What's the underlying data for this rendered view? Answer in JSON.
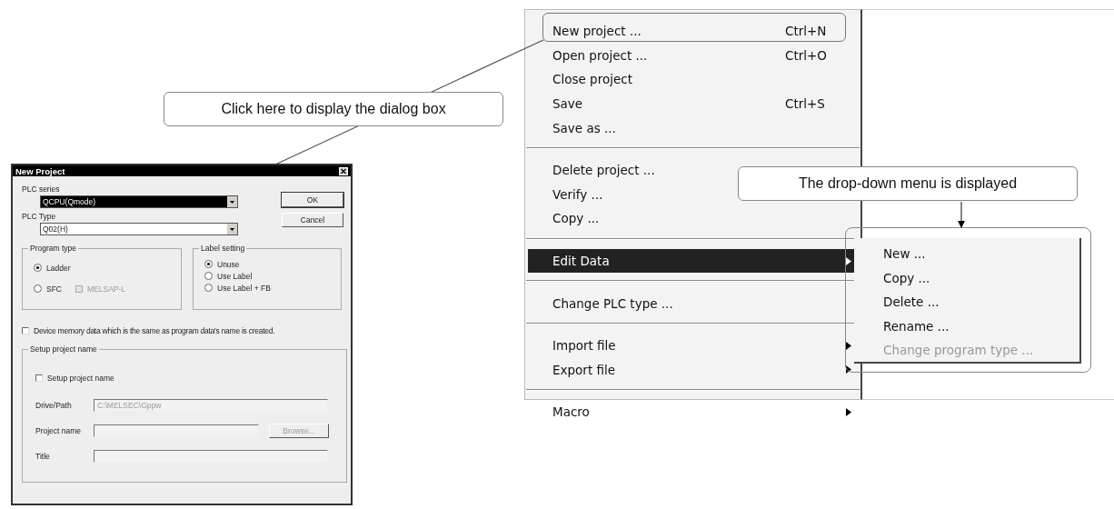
{
  "annotations": [
    {
      "text": "Click here to display the dialog box"
    },
    {
      "text": "The drop-down menu is displayed"
    }
  ],
  "dialog": {
    "title": "New Project",
    "plc_series": {
      "label": "PLC series",
      "value": "QCPU(Qmode)",
      "selected": true
    },
    "plc_type": {
      "label": "PLC Type",
      "value": "Q02(H)",
      "selected": false
    },
    "buttons": [
      {
        "label": "OK",
        "default": true
      },
      {
        "label": "Cancel",
        "default": false
      }
    ],
    "program_type": {
      "label": "Program type",
      "options": [
        {
          "kind": "radio",
          "label": "Ladder",
          "selected": true,
          "disabled": false
        },
        {
          "kind": "radio",
          "label": "SFC",
          "selected": false,
          "disabled": false
        },
        {
          "kind": "checkbox",
          "label": "MELSAP-L",
          "checked": false,
          "disabled": true
        }
      ]
    },
    "label_setting": {
      "label": "Label setting",
      "options": [
        {
          "kind": "radio",
          "label": "Unuse",
          "selected": true
        },
        {
          "kind": "radio",
          "label": "Use Label",
          "selected": false
        },
        {
          "kind": "radio",
          "label": "Use Label + FB",
          "selected": false
        }
      ]
    },
    "device_memory": {
      "label": "Device memory data which is the same as program data's name is created.",
      "checked": false
    },
    "setup": {
      "label": "Setup project name",
      "checkbox": {
        "label": "Setup project name",
        "checked": false
      },
      "fields": [
        {
          "label": "Drive/Path",
          "value": "C:\\MELSEC\\Gppw"
        },
        {
          "label": "Project name",
          "button": "Browse..."
        },
        {
          "label": "Title"
        }
      ]
    }
  },
  "menu": {
    "groups": [
      [
        {
          "label": "New project ...",
          "shortcut": "Ctrl+N",
          "selected": false,
          "submenu": false
        },
        {
          "label": "Open project ...",
          "shortcut": "Ctrl+O",
          "selected": false,
          "submenu": false
        },
        {
          "label": "Close project",
          "selected": false,
          "submenu": false
        },
        {
          "label": "Save",
          "shortcut": "Ctrl+S",
          "selected": false,
          "submenu": false
        },
        {
          "label": "Save as ...",
          "selected": false,
          "submenu": false
        }
      ],
      [
        {
          "label": "Delete project ...",
          "selected": false,
          "submenu": false
        },
        {
          "label": "Verify ...",
          "selected": false,
          "submenu": false
        },
        {
          "label": "Copy ...",
          "selected": false,
          "submenu": false
        }
      ],
      [
        {
          "label": "Edit Data",
          "selected": true,
          "submenu": true
        }
      ],
      [
        {
          "label": "Change PLC type ...",
          "selected": false,
          "submenu": false
        }
      ],
      [
        {
          "label": "Import file",
          "selected": false,
          "submenu": true
        },
        {
          "label": "Export file",
          "selected": false,
          "submenu": true
        }
      ],
      [
        {
          "label": "Macro",
          "selected": false,
          "submenu": true
        }
      ]
    ]
  },
  "submenu": {
    "items": [
      {
        "label": "New ...",
        "disabled": false
      },
      {
        "label": "Copy ...",
        "disabled": false
      },
      {
        "label": "Delete ...",
        "disabled": false
      },
      {
        "label": "Rename ...",
        "disabled": false
      },
      {
        "label": "Change program type ...",
        "disabled": true
      }
    ]
  }
}
